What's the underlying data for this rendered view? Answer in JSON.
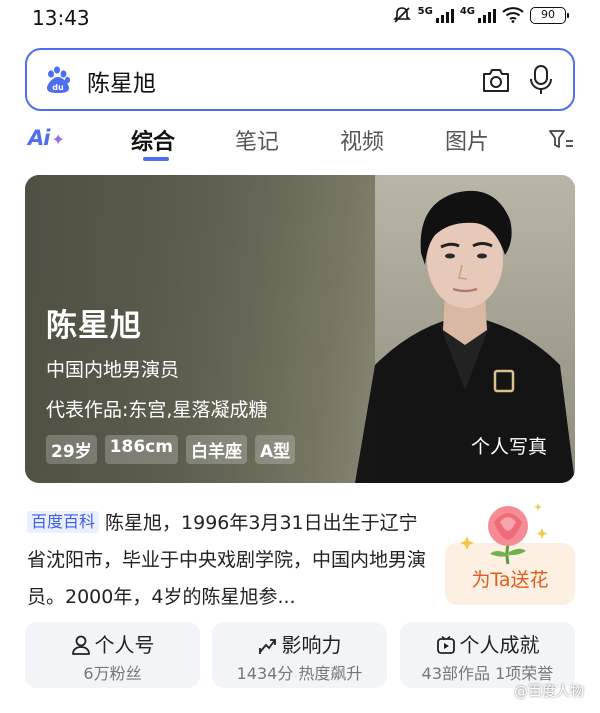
{
  "status_bar": {
    "time": "13:43",
    "network_5g": "5G",
    "network_4g": "4G",
    "battery": "90"
  },
  "search": {
    "query": "陈星旭"
  },
  "tabs": {
    "ai_label": "Ai",
    "items": [
      {
        "label": "综合",
        "active": true
      },
      {
        "label": "笔记",
        "active": false
      },
      {
        "label": "视频",
        "active": false
      },
      {
        "label": "图片",
        "active": false
      }
    ]
  },
  "hero": {
    "name": "陈星旭",
    "role": "中国内地男演员",
    "works": "代表作品:东宫,星落凝成糖",
    "chips": [
      "29岁",
      "186cm",
      "白羊座",
      "A型"
    ],
    "photo_link": "个人写真"
  },
  "intro": {
    "tag": "百度百科",
    "text": "陈星旭，1996年3月31日出生于辽宁省沈阳市，毕业于中央戏剧学院，中国内地男演员。2000年，4岁的陈星旭参..."
  },
  "flower": {
    "label": "为Ta送花"
  },
  "stats": [
    {
      "title": "个人号",
      "sub": "6万粉丝",
      "icon": "person-icon"
    },
    {
      "title": "影响力",
      "sub": "1434分  热度飙升",
      "icon": "trend-icon"
    },
    {
      "title": "个人成就",
      "sub": "43部作品 1项荣誉",
      "icon": "play-badge-icon"
    }
  ],
  "watermark": "@百度人物",
  "colors": {
    "accent": "#4e6ef2",
    "flower_text": "#e25a1c",
    "card_bg": "#f3f4f8"
  }
}
